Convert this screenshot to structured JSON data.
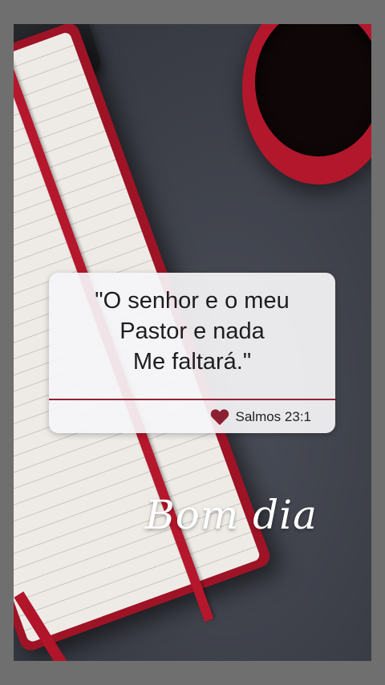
{
  "quote": {
    "lines": [
      "\"O senhor e o meu",
      "Pastor e nada",
      "Me faltará.\""
    ],
    "reference": "Salmos 23:1",
    "reference_icon": "heart-icon"
  },
  "greeting": "Bom dia",
  "colors": {
    "accent": "#8e2535",
    "heart": "#8c1f33",
    "cup": "#b3172c",
    "background": "#3b3e47"
  }
}
